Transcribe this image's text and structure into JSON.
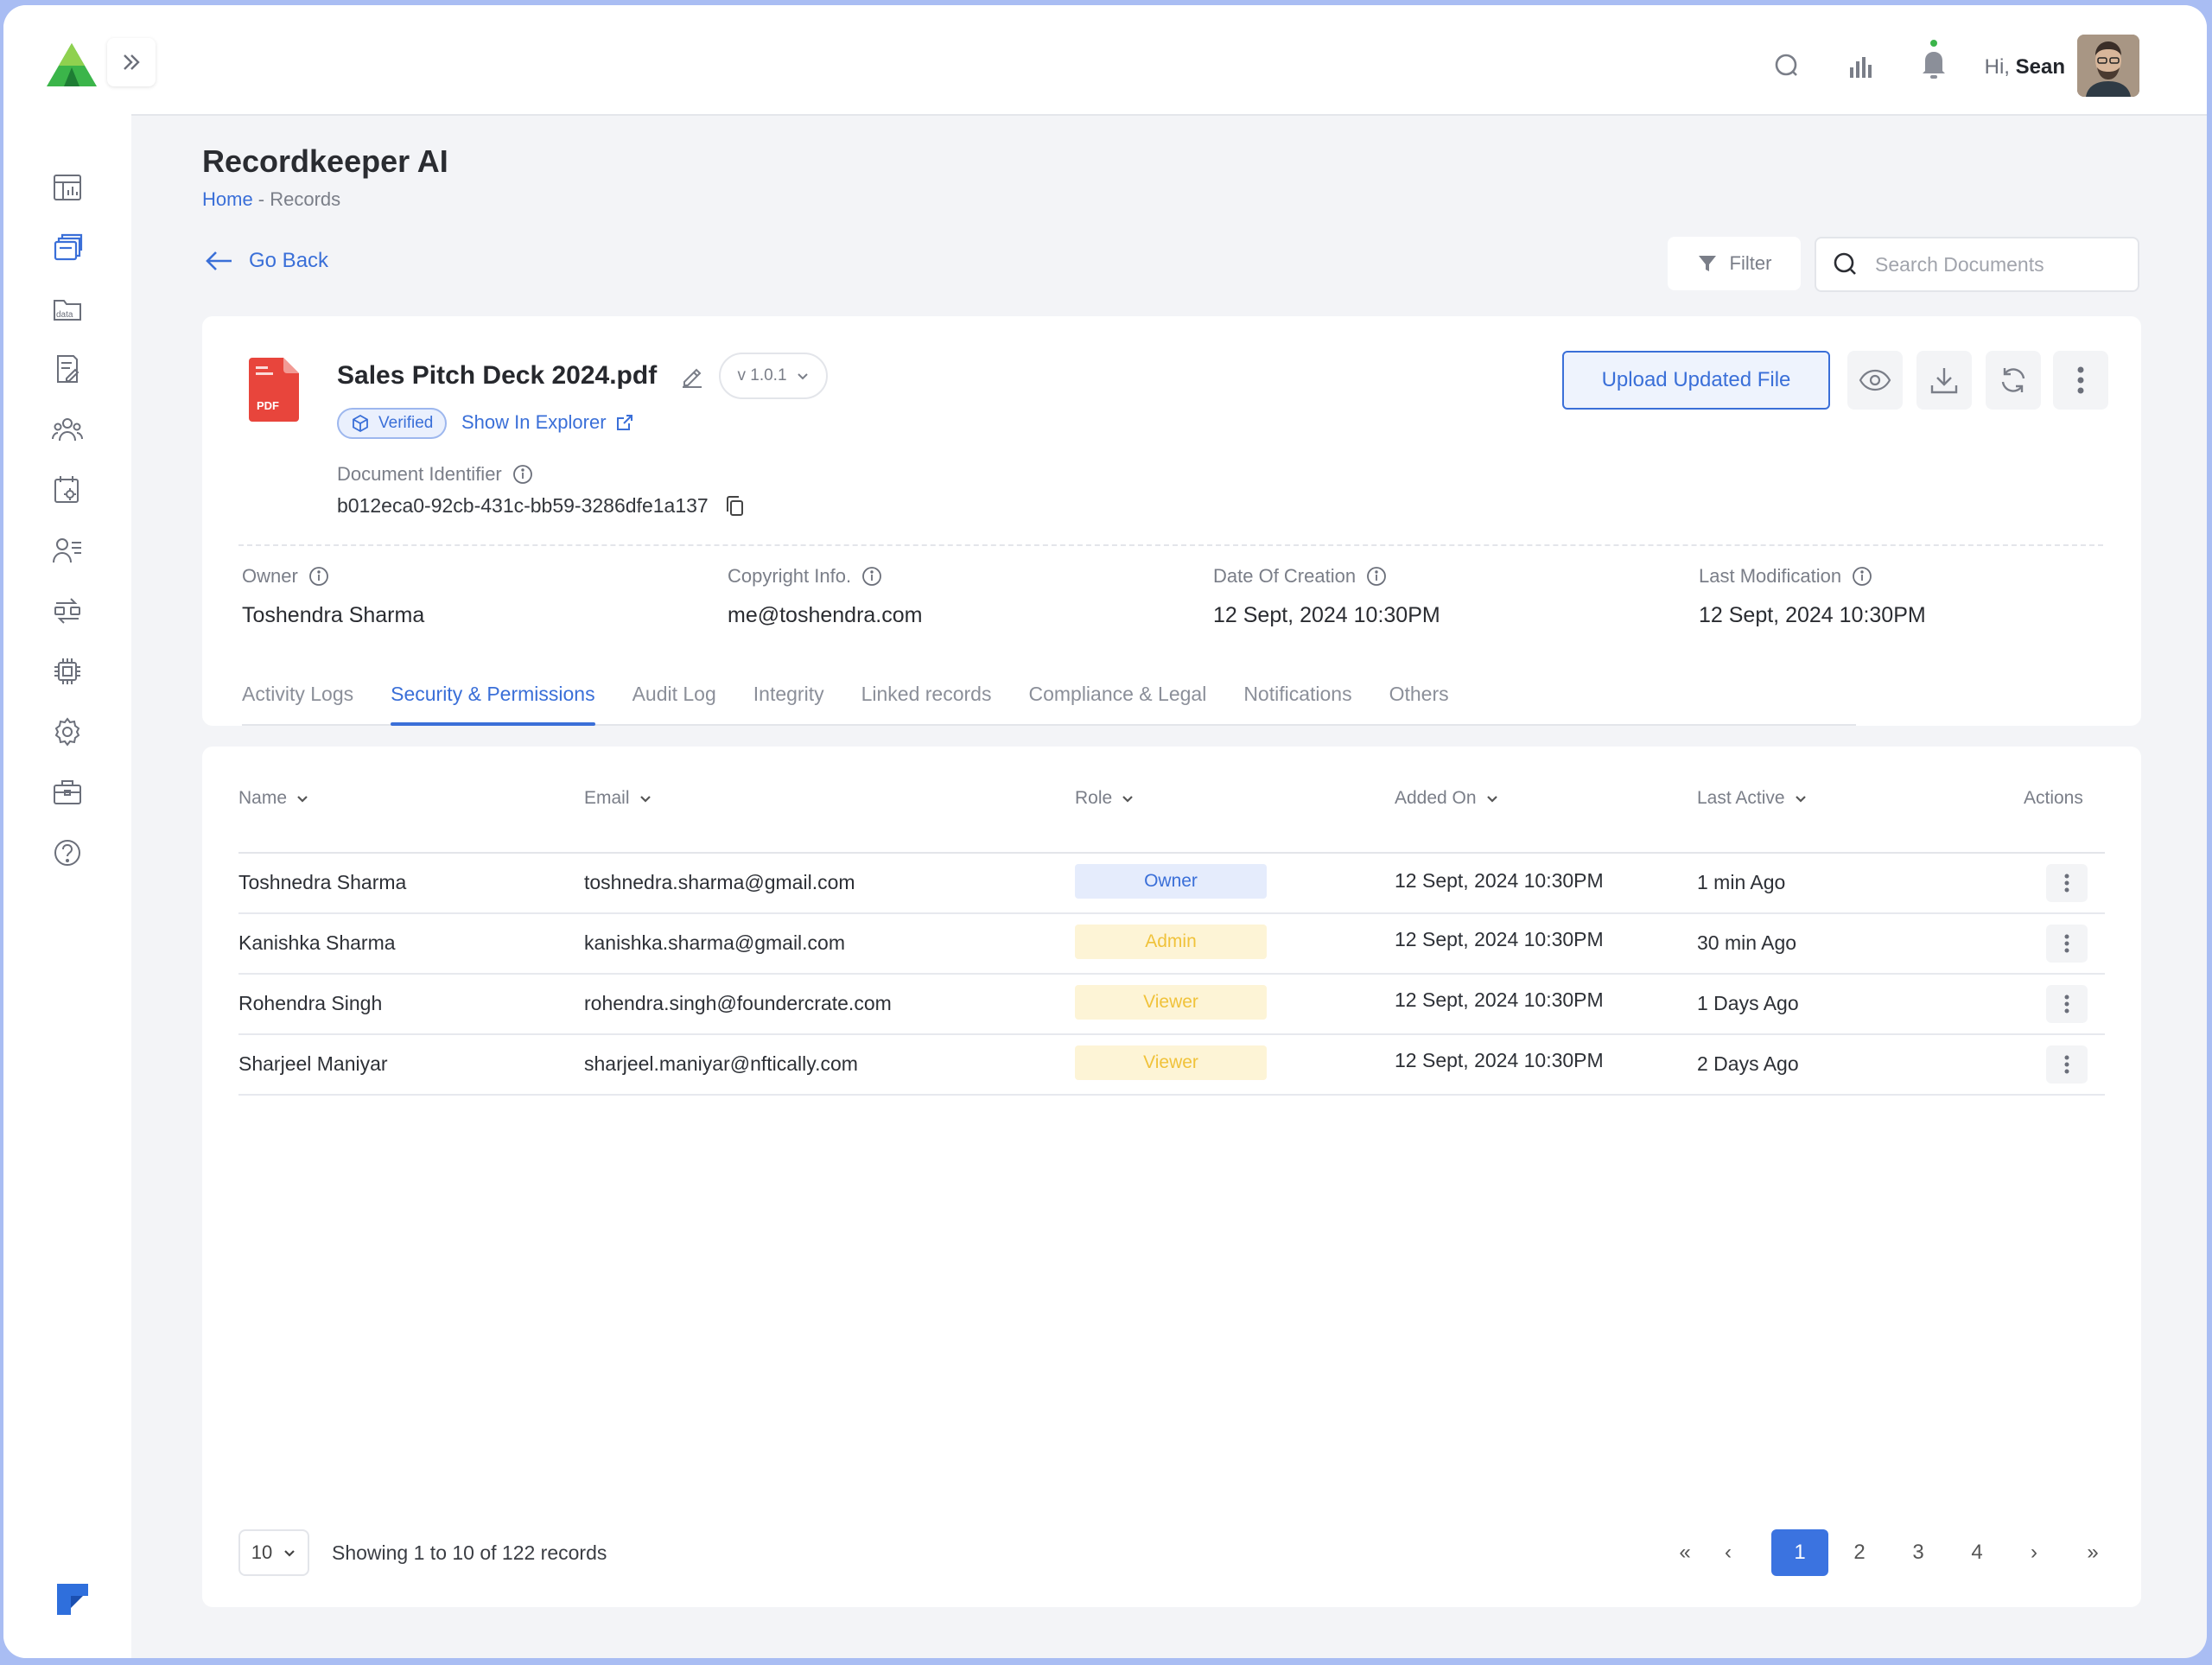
{
  "app": {
    "title": "Recordkeeper AI"
  },
  "breadcrumb": {
    "home": "Home",
    "separator": " - ",
    "current": "Records"
  },
  "header": {
    "greeting_prefix": "Hi, ",
    "user_name": "Sean"
  },
  "nav": {
    "go_back": "Go Back"
  },
  "toolbar": {
    "filter_label": "Filter",
    "search_placeholder": "Search Documents"
  },
  "document": {
    "name": "Sales Pitch Deck 2024.pdf",
    "version": "v 1.0.1",
    "verified_label": "Verified",
    "explorer_label": "Show In Explorer",
    "file_type": "PDF",
    "identifier_label": "Document Identifier",
    "identifier": "b012eca0-92cb-431c-bb59-3286dfe1a137",
    "upload_label": "Upload Updated File"
  },
  "meta": [
    {
      "label": "Owner",
      "value": "Toshendra Sharma"
    },
    {
      "label": "Copyright Info.",
      "value": "me@toshendra.com"
    },
    {
      "label": "Date Of Creation",
      "value": "12 Sept, 2024 10:30PM"
    },
    {
      "label": "Last Modification",
      "value": "12 Sept, 2024 10:30PM"
    }
  ],
  "tabs": [
    {
      "label": "Activity Logs"
    },
    {
      "label": "Security & Permissions"
    },
    {
      "label": "Audit Log"
    },
    {
      "label": "Integrity"
    },
    {
      "label": "Linked records"
    },
    {
      "label": "Compliance & Legal"
    },
    {
      "label": "Notifications"
    },
    {
      "label": "Others"
    }
  ],
  "active_tab": "Security & Permissions",
  "table": {
    "columns": {
      "name": "Name",
      "email": "Email",
      "role": "Role",
      "added_on": "Added On",
      "last_active": "Last Active",
      "actions": "Actions"
    },
    "rows": [
      {
        "name": "Toshnedra Sharma",
        "email": "toshnedra.sharma@gmail.com",
        "role": "Owner",
        "added_on": "12 Sept, 2024 10:30PM",
        "last_active": "1 min Ago"
      },
      {
        "name": "Kanishka Sharma",
        "email": "kanishka.sharma@gmail.com",
        "role": "Admin",
        "added_on": "12 Sept, 2024 10:30PM",
        "last_active": "30 min Ago"
      },
      {
        "name": "Rohendra Singh",
        "email": "rohendra.singh@foundercrate.com",
        "role": "Viewer",
        "added_on": "12 Sept, 2024 10:30PM",
        "last_active": "1 Days Ago"
      },
      {
        "name": "Sharjeel Maniyar",
        "email": "sharjeel.maniyar@nftically.com",
        "role": "Viewer",
        "added_on": "12 Sept, 2024 10:30PM",
        "last_active": "2 Days Ago"
      }
    ]
  },
  "pagination": {
    "per_page": "10",
    "showing": "Showing 1 to 10 of 122 records",
    "first": "«",
    "prev": "‹",
    "pages": [
      "1",
      "2",
      "3",
      "4"
    ],
    "current_page": "1",
    "next": "›",
    "last": "»"
  },
  "colors": {
    "accent": "#3a6fd8",
    "owner_bg": "#e5ecfc",
    "admin_bg": "#fdf4d6",
    "pdf_red": "#e8453c",
    "logo_green": "#3bb54a"
  }
}
